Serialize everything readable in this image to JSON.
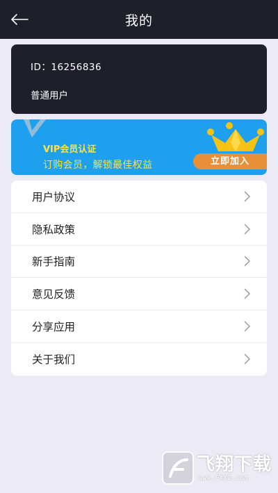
{
  "header": {
    "title": "我的",
    "back_icon": "arrow-left-icon"
  },
  "profile": {
    "id_label": "ID：16256836",
    "user_type": "普通用户"
  },
  "vip": {
    "title": "VIP会员认证",
    "subtitle": "订购会员，解锁最佳权益",
    "join_label": "立即加入",
    "colors": {
      "banner": "#1fa0ef",
      "text": "#ffe23a",
      "button": "#e98f37",
      "crown": "#f6c315"
    }
  },
  "menu": {
    "items": [
      {
        "label": "用户协议"
      },
      {
        "label": "隐私政策"
      },
      {
        "label": "新手指南"
      },
      {
        "label": "意见反馈"
      },
      {
        "label": "分享应用"
      },
      {
        "label": "关于我们"
      }
    ]
  },
  "watermark": {
    "text": "飞翔下载",
    "url": "www.FXXZ.com"
  }
}
